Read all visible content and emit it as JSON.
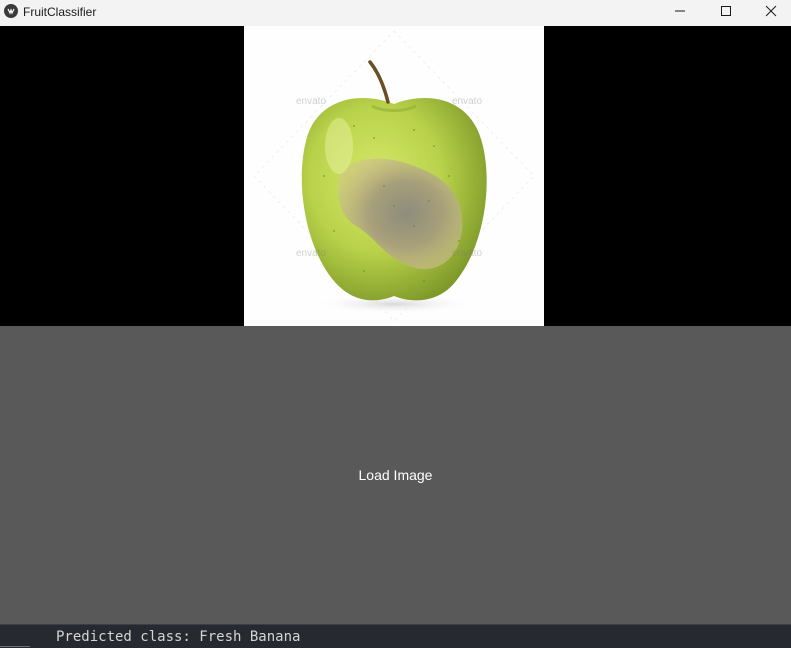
{
  "window": {
    "title": "FruitClassifier",
    "icon": "app-logo-icon",
    "controls": {
      "minimize_icon": "minimize-icon",
      "maximize_icon": "maximize-icon",
      "close_icon": "close-icon"
    }
  },
  "image_preview": {
    "subject": "green apple with bruise",
    "watermarks": [
      "envato",
      "envato",
      "envato",
      "envato"
    ]
  },
  "load_button": {
    "label": "Load Image"
  },
  "status": {
    "text": "Predicted class: Fresh Banana"
  },
  "colors": {
    "titlebar_bg": "#f3f3f3",
    "background": "#000000",
    "button_bg": "#595959",
    "button_text": "#ffffff",
    "status_bg": "#262a30",
    "status_text": "#d4d4d4"
  }
}
